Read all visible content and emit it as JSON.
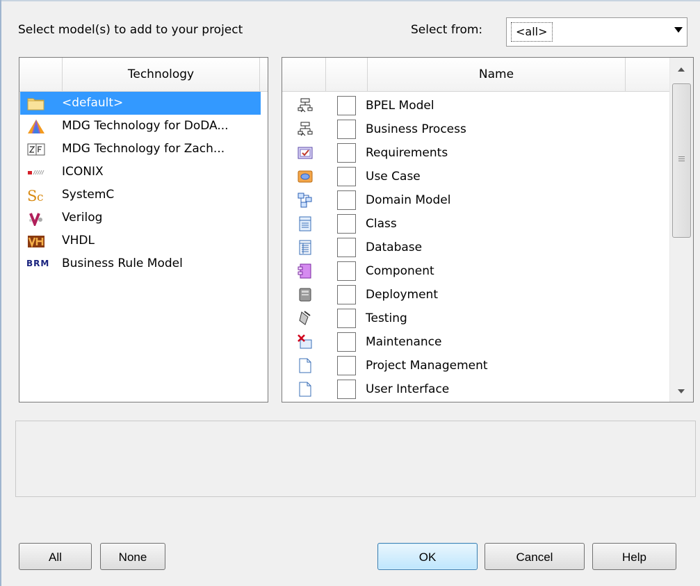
{
  "header": {
    "prompt": "Select model(s) to add to your project",
    "select_from_label": "Select from:",
    "select_from_value": "<all>"
  },
  "technology_list": {
    "column_header": "Technology",
    "items": [
      {
        "label": "<default>",
        "icon": "folder-icon",
        "selected": true
      },
      {
        "label": "MDG Technology for DoDA...",
        "icon": "dodaf-triangle-icon"
      },
      {
        "label": "MDG Technology for Zach...",
        "icon": "zf-icon"
      },
      {
        "label": "ICONIX",
        "icon": "iconix-icon"
      },
      {
        "label": "SystemC",
        "icon": "systemc-icon"
      },
      {
        "label": "Verilog",
        "icon": "verilog-icon"
      },
      {
        "label": "VHDL",
        "icon": "vhdl-icon"
      },
      {
        "label": "Business Rule Model",
        "icon": "brm-icon",
        "icon_text": "BRM"
      }
    ]
  },
  "model_list": {
    "column_header": "Name",
    "items": [
      {
        "label": "BPEL Model",
        "icon": "bpel-icon",
        "checked": false
      },
      {
        "label": "Business Process",
        "icon": "business-process-icon",
        "checked": false
      },
      {
        "label": "Requirements",
        "icon": "requirements-icon",
        "checked": false
      },
      {
        "label": "Use Case",
        "icon": "use-case-icon",
        "checked": false
      },
      {
        "label": "Domain Model",
        "icon": "domain-model-icon",
        "checked": false
      },
      {
        "label": "Class",
        "icon": "class-icon",
        "checked": false
      },
      {
        "label": "Database",
        "icon": "database-icon",
        "checked": false
      },
      {
        "label": "Component",
        "icon": "component-icon",
        "checked": false
      },
      {
        "label": "Deployment",
        "icon": "deployment-icon",
        "checked": false
      },
      {
        "label": "Testing",
        "icon": "testing-icon",
        "checked": false
      },
      {
        "label": "Maintenance",
        "icon": "maintenance-icon",
        "checked": false
      },
      {
        "label": "Project Management",
        "icon": "document-icon",
        "checked": false
      },
      {
        "label": "User Interface",
        "icon": "document-icon",
        "checked": false
      }
    ]
  },
  "buttons": {
    "all": "All",
    "none": "None",
    "ok": "OK",
    "cancel": "Cancel",
    "help": "Help"
  },
  "colors": {
    "selection": "#3399ff",
    "dialog_bg": "#f0f0f0",
    "default_button": "#bee6fd"
  }
}
